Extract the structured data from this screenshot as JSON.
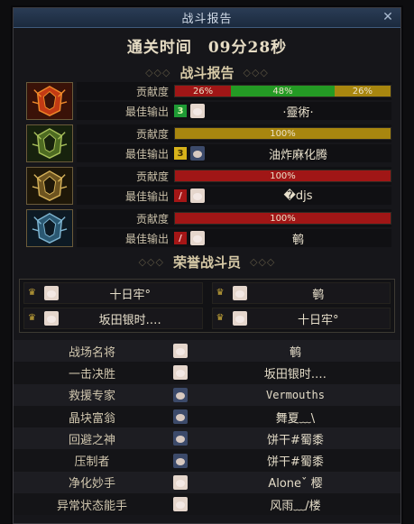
{
  "window": {
    "title": "战斗报告",
    "close_glyph": "✕"
  },
  "clear_time": {
    "label": "通关时间",
    "value": "09分28秒"
  },
  "report_header": "战斗报告",
  "labels": {
    "contribution": "贡献度",
    "best_output": "最佳输出"
  },
  "players": [
    {
      "class_icon": "fire-warrior-portrait",
      "contribution": [
        {
          "value": 26,
          "text": "26%",
          "color": "#a01616"
        },
        {
          "value": 48,
          "text": "48%",
          "color": "#249a24"
        },
        {
          "value": 26,
          "text": "26%",
          "color": "#a8860f"
        }
      ],
      "best_badge": "3",
      "best_badge_color": "green",
      "best_name": "·靈術·"
    },
    {
      "class_icon": "green-knight-portrait",
      "contribution": [
        {
          "value": 100,
          "text": "100%",
          "color": "#a8860f"
        }
      ],
      "best_badge": "3",
      "best_badge_color": "yellow",
      "best_name": "油炸麻化腾"
    },
    {
      "class_icon": "gold-knight-portrait",
      "contribution": [
        {
          "value": 100,
          "text": "100%",
          "color": "#a01616"
        }
      ],
      "best_badge": "/",
      "best_badge_color": "red",
      "best_name": "�djs"
    },
    {
      "class_icon": "blue-knight-portrait",
      "contribution": [
        {
          "value": 100,
          "text": "100%",
          "color": "#a01616"
        }
      ],
      "best_badge": "/",
      "best_badge_color": "red",
      "best_name": "鹌"
    }
  ],
  "honor_header": "荣誉战斗员",
  "honor": [
    {
      "name": "十日牢°"
    },
    {
      "name": "鹌"
    },
    {
      "name": "坂田银时.…"
    },
    {
      "name": "十日牢°"
    }
  ],
  "awards": [
    {
      "title": "战场名将",
      "player": "鹌",
      "mono": false
    },
    {
      "title": "一击决胜",
      "player": "坂田银时.…",
      "mono": false
    },
    {
      "title": "救援专家",
      "player": "Vermouths",
      "mono": true
    },
    {
      "title": "晶块富翁",
      "player": "舞夏﹏\\",
      "mono": false
    },
    {
      "title": "回避之神",
      "player": "饼干#蜀黍",
      "mono": false
    },
    {
      "title": "压制者",
      "player": "饼干#蜀黍",
      "mono": false
    },
    {
      "title": "净化妙手",
      "player": "Aloneˇ 樱",
      "mono": false
    },
    {
      "title": "异常状态能手",
      "player": "风雨﹏/楼",
      "mono": false
    }
  ]
}
